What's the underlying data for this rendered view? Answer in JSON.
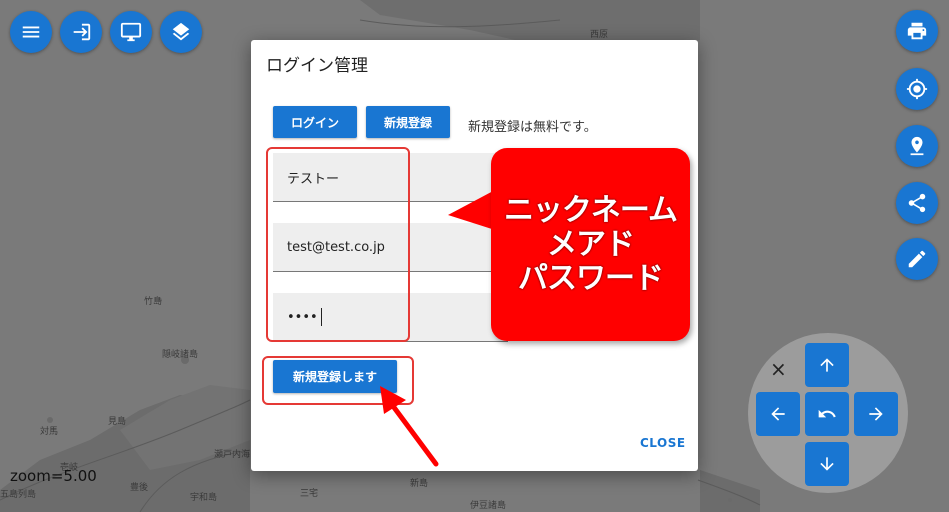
{
  "map": {
    "zoom_text": "zoom=5.00",
    "place_labels": [
      "竹島",
      "隠岐諸島",
      "見島",
      "対馬",
      "壱岐",
      "五島列島",
      "瀬戸内海",
      "伊豆諸島",
      "三宅",
      "新島",
      "豊後",
      "宇和島",
      "西原"
    ]
  },
  "toolbar_left": {
    "icons": [
      "menu-icon",
      "login-icon",
      "monitor-icon",
      "layers-icon"
    ]
  },
  "toolbar_right": {
    "icons": [
      "print-icon",
      "gps-icon",
      "map-pin-icon",
      "share-icon",
      "edit-icon"
    ]
  },
  "dpad": {
    "close_text": "×",
    "icons": [
      "arrow-up-icon",
      "arrow-left-icon",
      "undo-icon",
      "arrow-right-icon",
      "arrow-down-icon"
    ]
  },
  "dialog": {
    "title": "ログイン管理",
    "login_tab": "ログイン",
    "register_tab": "新規登録",
    "note": "新規登録は無料です。",
    "fields": {
      "nickname_value": "テストー",
      "email_value": "test@test.co.jp",
      "password_value": "••••"
    },
    "submit_label": "新規登録します",
    "close_label": "CLOSE"
  },
  "annotation": {
    "lines": [
      "ニックネーム",
      "メアド",
      "パスワード"
    ],
    "color": "#ff0000"
  },
  "colors": {
    "accent": "#1976d2",
    "highlight": "#e53935"
  }
}
